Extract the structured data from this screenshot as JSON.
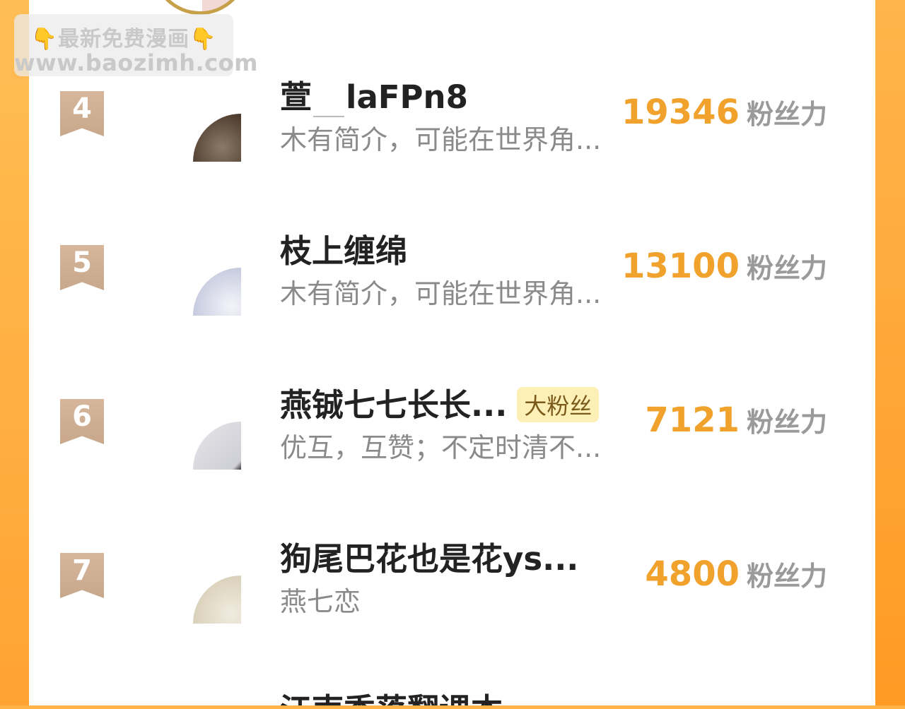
{
  "watermark": {
    "line1": "最新免费漫画",
    "hand_left": "👇",
    "hand_right": "👇",
    "line2": "www.baozimh.com"
  },
  "rows": [
    {
      "rank": "4",
      "name_part1": "萱",
      "name_part2": "laFPn8",
      "desc": "木有简介，可能在世界角...",
      "score": "19346",
      "unit": "粉丝力",
      "avatar_color": "#5a4432"
    },
    {
      "rank": "5",
      "name": "枝上缠绵",
      "desc": "木有简介，可能在世界角...",
      "score": "13100",
      "unit": "粉丝力",
      "avatar_color": "#dfe2ee"
    },
    {
      "rank": "6",
      "name": "燕铖七七长长...",
      "badge": "大粉丝",
      "desc": "优互，互赞；不定时清不...",
      "score": "7121",
      "unit": "粉丝力",
      "avatar_color": "#d9d9dc"
    },
    {
      "rank": "7",
      "name": "狗尾巴花也是花ys...",
      "desc": "燕七恋",
      "score": "4800",
      "unit": "粉丝力",
      "avatar_color": "#e8dfcb"
    }
  ],
  "next_row_partial": "江南秀落翻课本"
}
